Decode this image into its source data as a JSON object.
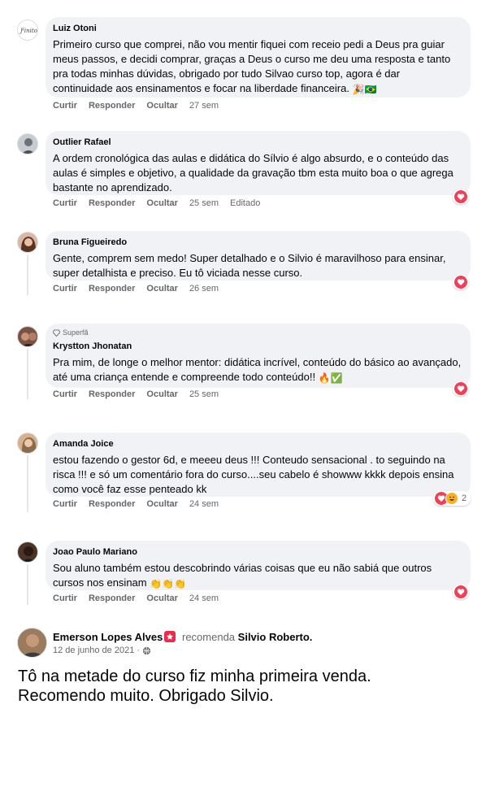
{
  "comments": [
    {
      "author": "Luiz Otoni",
      "text": "Primeiro curso que comprei, não vou mentir fiquei com receio pedi a Deus pra guiar meus passos, e decidi comprar, graças a Deus o curso me deu uma resposta e tanto pra todas minhas dúvidas, obrigado por tudo Silvao curso top, agora é dar continuidade aos ensinamentos e focar na liberdade financeira.",
      "emoji": "🎉🇧🇷",
      "time": "27 sem",
      "avatar_color": "#ffffff"
    },
    {
      "author": "Outlier Rafael",
      "text": "A ordem cronológica das aulas e didática do Sílvio é algo absurdo, e o conteúdo das aulas é simples e objetivo, a qualidade da gravação tbm esta muito boa o que agrega bastante no aprendizado.",
      "time": "25 sem",
      "edited": "Editado",
      "avatar_color": "#8a8f96"
    },
    {
      "author": "Bruna Figueiredo",
      "text": "Gente, comprem sem medo! Super detalhado e o Silvio é maravilhoso para ensinar, super detalhista e preciso. Eu tô viciada nesse curso.",
      "time": "26 sem",
      "avatar_color": "#b07a5a"
    },
    {
      "badge": "Superfã",
      "author": "Krystton Jhonatan",
      "text": "Pra mim, de longe o melhor mentor: didática incrível, conteúdo do básico ao avançado, até uma criança entende e compreende todo conteúdo!!",
      "emoji": "🔥✅",
      "time": "25 sem",
      "avatar_color": "#5a3a2e"
    },
    {
      "author": "Amanda Joice",
      "text": "estou fazendo o gestor 6d, e meeeu deus !!! Conteudo sensacional . to seguindo na risca !!! e só um comentário fora do curso....seu cabelo é showww kkkk depois ensina como você faz esse penteado kk",
      "time": "24 sem",
      "reaction_count": "2",
      "avatar_color": "#c9a27a"
    },
    {
      "author": "Joao Paulo Mariano",
      "text": "Sou aluno também estou descobrindo várias coisas que eu não sabiá que outros cursos nos ensinam",
      "emoji": "👏👏👏",
      "time": "24 sem",
      "avatar_color": "#3a2a20"
    }
  ],
  "actions": {
    "like": "Curtir",
    "reply": "Responder",
    "hide": "Ocultar"
  },
  "post": {
    "author": "Emerson Lopes Alves",
    "recommends": "recomenda",
    "page": "Silvio Roberto.",
    "date": "12 de junho de 2021 ·",
    "text_line1": "Tô na metade do curso fiz minha primeira venda.",
    "text_line2": "Recomendo muito. Obrigado Silvio."
  },
  "colors": {
    "bubble": "#f0f2f5",
    "muted": "#65676b",
    "heart": "#f33e58",
    "haha": "#f7b125"
  }
}
